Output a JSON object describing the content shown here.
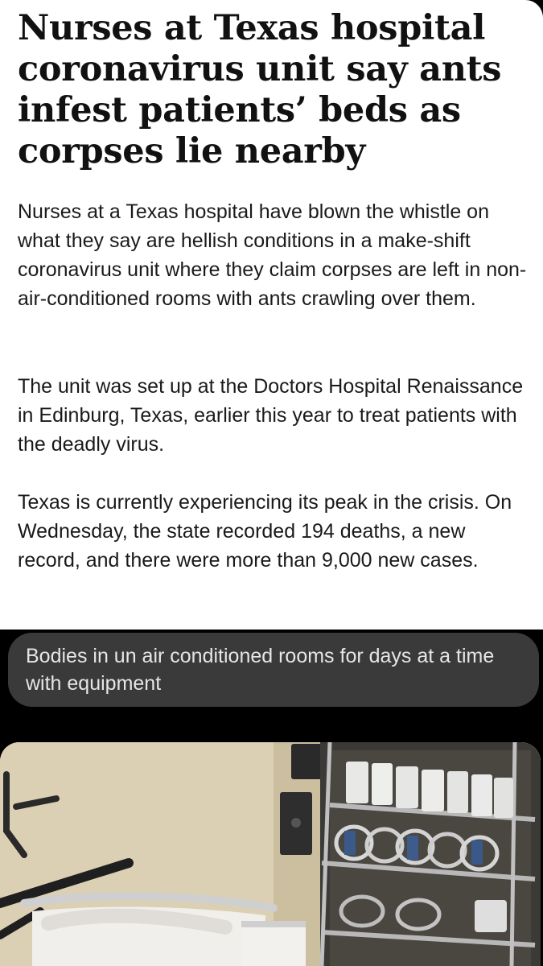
{
  "article": {
    "headline": "Nurses at Texas hospital coronavirus unit say ants infest patients’ beds as corpses lie nearby",
    "paragraphs": [
      "Nurses at a Texas hospital have blown the whistle on what they say are hellish conditions in a make-shift coronavirus unit where they claim corpses are left in non-air-conditioned rooms with ants crawling over them.",
      "The unit was set up at the Doctors Hospital Renaissance in Edinburg, Texas, earlier this year to treat patients with the deadly virus.",
      "Texas is currently experiencing its peak in the crisis. On Wednesday, the state recorded 194 deaths, a new record, and there were more than 9,000 new cases."
    ]
  },
  "message": {
    "text": "Bodies in un air conditioned rooms for days at a time with equipment"
  },
  "colors": {
    "article_bg": "#ffffff",
    "text": "#1a1a1a",
    "screen_bg": "#000000",
    "bubble_bg": "#3a3a3a",
    "bubble_text": "#e6e6e6"
  }
}
